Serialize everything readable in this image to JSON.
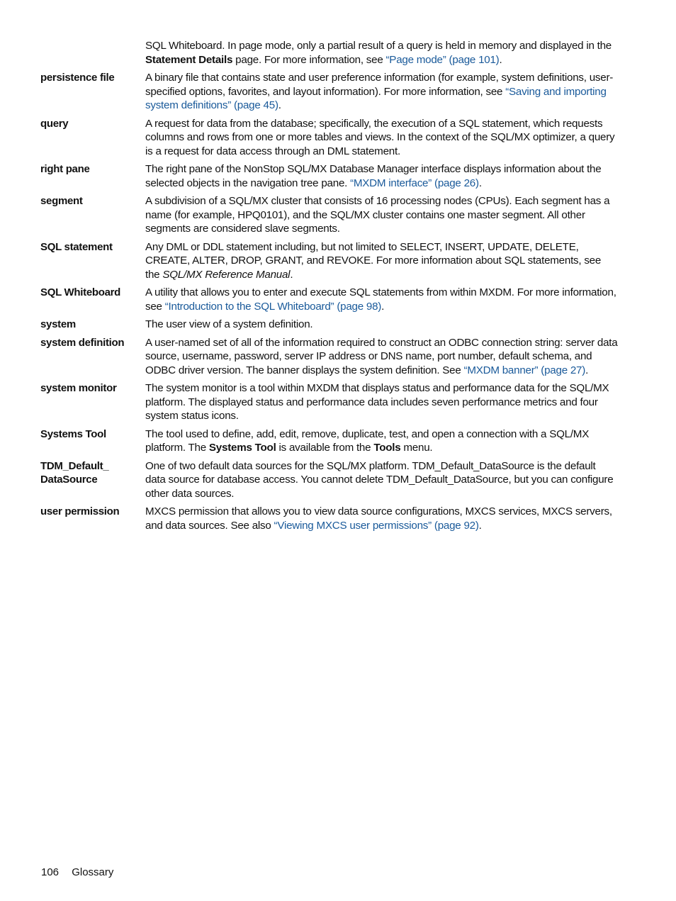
{
  "colors": {
    "text": "#111111",
    "link": "#1a5a9a",
    "background": "#ffffff"
  },
  "entries": [
    {
      "term": "",
      "parts": [
        {
          "t": "text",
          "v": "SQL Whiteboard. In page mode, only a partial result of a query is held in memory and displayed in the "
        },
        {
          "t": "bold",
          "v": "Statement Details"
        },
        {
          "t": "text",
          "v": " page. For more information, see "
        },
        {
          "t": "link",
          "v": "“Page mode” (page 101)"
        },
        {
          "t": "text",
          "v": "."
        }
      ]
    },
    {
      "term": "persistence file",
      "parts": [
        {
          "t": "text",
          "v": "A binary file that contains state and user preference information (for example, system definitions, user-specified options, favorites, and layout information). For more information, see "
        },
        {
          "t": "link",
          "v": "“Saving and importing system definitions” (page 45)"
        },
        {
          "t": "text",
          "v": "."
        }
      ]
    },
    {
      "term": "query",
      "parts": [
        {
          "t": "text",
          "v": "A request for data from the database; specifically, the execution of a SQL statement, which requests columns and rows from one or more tables and views. In the context of the SQL/MX optimizer, a query is a request for data access through an DML statement."
        }
      ]
    },
    {
      "term": "right pane",
      "parts": [
        {
          "t": "text",
          "v": "The right pane of the NonStop SQL/MX Database Manager interface displays information about the selected objects in the navigation tree pane. "
        },
        {
          "t": "link",
          "v": "“MXDM interface” (page 26)"
        },
        {
          "t": "text",
          "v": "."
        }
      ]
    },
    {
      "term": "segment",
      "parts": [
        {
          "t": "text",
          "v": "A subdivision of a SQL/MX cluster that consists of 16 processing nodes (CPUs). Each segment has a name (for example, HPQ0101), and the SQL/MX cluster contains one master segment. All other segments are considered slave segments."
        }
      ]
    },
    {
      "term": "SQL statement",
      "parts": [
        {
          "t": "text",
          "v": "Any DML or DDL statement including, but not limited to SELECT, INSERT, UPDATE, DELETE, CREATE, ALTER, DROP, GRANT, and REVOKE. For more information about SQL statements, see the "
        },
        {
          "t": "italic",
          "v": "SQL/MX Reference Manual"
        },
        {
          "t": "text",
          "v": "."
        }
      ]
    },
    {
      "term": "SQL Whiteboard",
      "parts": [
        {
          "t": "text",
          "v": "A utility that allows you to enter and execute SQL statements from within MXDM. For more information, see "
        },
        {
          "t": "link",
          "v": "“Introduction to the SQL Whiteboard” (page 98)"
        },
        {
          "t": "text",
          "v": "."
        }
      ]
    },
    {
      "term": "system",
      "parts": [
        {
          "t": "text",
          "v": "The user view of a system definition."
        }
      ]
    },
    {
      "term": "system definition",
      "parts": [
        {
          "t": "text",
          "v": "A user-named set of all of the information required to construct an ODBC connection string: server data source, username, password, server IP address or DNS name, port number, default schema, and ODBC driver version. The banner displays the system definition. See "
        },
        {
          "t": "link",
          "v": "“MXDM banner” (page 27)"
        },
        {
          "t": "text",
          "v": "."
        }
      ]
    },
    {
      "term": "system monitor",
      "parts": [
        {
          "t": "text",
          "v": "The system monitor is a tool within MXDM that displays status and performance data for the SQL/MX platform. The displayed status and performance data includes seven performance metrics and four system status icons."
        }
      ]
    },
    {
      "term": "Systems Tool",
      "parts": [
        {
          "t": "text",
          "v": "The tool used to define, add, edit, remove, duplicate, test, and open a connection with a SQL/MX platform. The "
        },
        {
          "t": "bold",
          "v": "Systems Tool"
        },
        {
          "t": "text",
          "v": " is available from the "
        },
        {
          "t": "bold",
          "v": "Tools"
        },
        {
          "t": "text",
          "v": " menu."
        }
      ]
    },
    {
      "term": "TDM_Default_ DataSource",
      "parts": [
        {
          "t": "text",
          "v": "One of two default data sources for the SQL/MX platform. TDM_Default_DataSource is the default data source for database access. You cannot delete TDM_Default_DataSource, but you can configure other data sources."
        }
      ]
    },
    {
      "term": "user permission",
      "parts": [
        {
          "t": "text",
          "v": "MXCS permission that allows you to view data source configurations, MXCS services, MXCS servers, and data sources. See also "
        },
        {
          "t": "link",
          "v": "“Viewing MXCS user permissions” (page 92)"
        },
        {
          "t": "text",
          "v": "."
        }
      ]
    }
  ],
  "footer": {
    "page_number": "106",
    "section": "Glossary"
  }
}
